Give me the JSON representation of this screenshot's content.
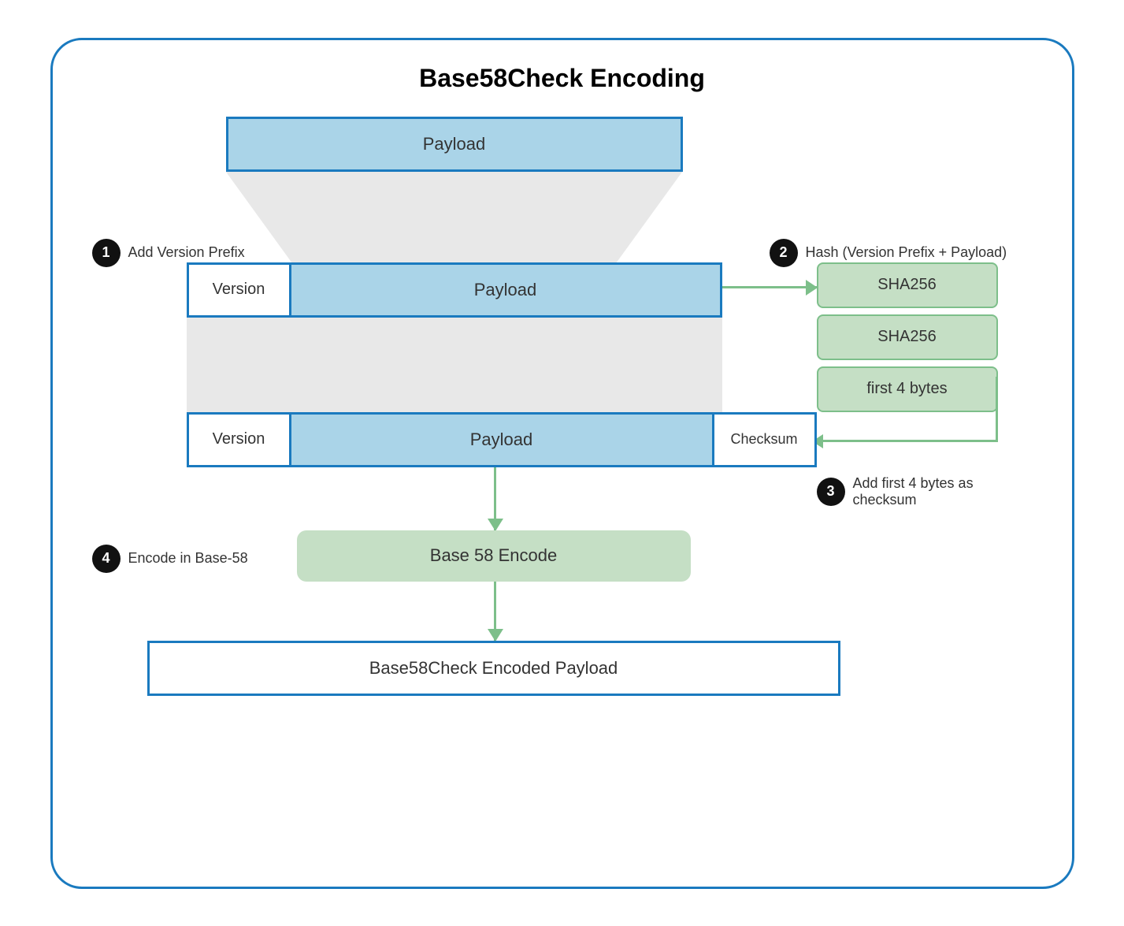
{
  "title": "Base58Check Encoding",
  "blocks": {
    "payload_top": "Payload",
    "version": "Version",
    "payload": "Payload",
    "checksum": "Checksum",
    "sha256_1": "SHA256",
    "sha256_2": "SHA256",
    "first4bytes": "first 4 bytes",
    "base58encode": "Base 58 Encode",
    "final": "Base58Check Encoded Payload"
  },
  "steps": {
    "step1_number": "1",
    "step1_label": "Add Version Prefix",
    "step2_number": "2",
    "step2_label": "Hash (Version Prefix + Payload)",
    "step3_number": "3",
    "step3_label": "Add first 4 bytes as checksum",
    "step4_number": "4",
    "step4_label": "Encode in Base-58"
  }
}
